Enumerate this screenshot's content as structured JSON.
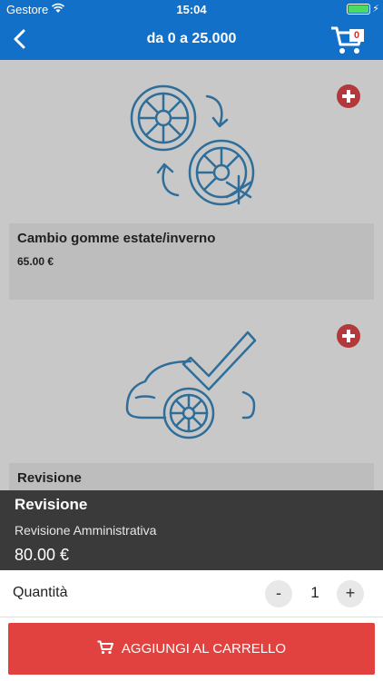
{
  "status_bar": {
    "carrier": "Gestore",
    "time": "15:04"
  },
  "nav": {
    "title": "da 0 a 25.000",
    "cart_count": "0",
    "icons": {
      "back": "chevron-left-icon",
      "cart": "cart-icon"
    }
  },
  "services": [
    {
      "name": "Cambio gomme estate/inverno",
      "price": "65.00 €",
      "icon": "tire-change-icon"
    },
    {
      "name": "Revisione",
      "price": "",
      "icon": "car-inspection-icon"
    }
  ],
  "detail": {
    "title": "Revisione",
    "subtitle": "Revisione Amministrativa",
    "price": "80.00 €"
  },
  "quantity": {
    "label": "Quantità",
    "minus": "-",
    "value": "1",
    "plus": "+"
  },
  "add_to_cart": {
    "label": "AGGIUNGI AL CARRELLO"
  },
  "colors": {
    "primary": "#1270c8",
    "accent_red": "#e1423f",
    "icon_line": "#2e6e99",
    "overlay_gray": "#c8c8c8",
    "panel_dark": "#3a3a3a"
  }
}
